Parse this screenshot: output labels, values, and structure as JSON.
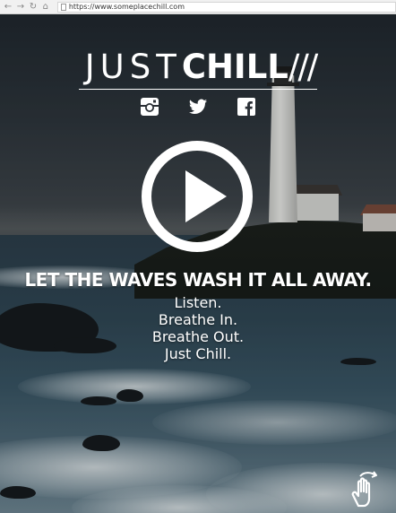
{
  "browser": {
    "back_icon": "back-arrow-icon",
    "forward_icon": "forward-arrow-icon",
    "reload_icon": "reload-icon",
    "home_icon": "home-icon",
    "url": "https://www.someplacechill.com"
  },
  "brand": {
    "word_thin": "JUST",
    "word_bold": "CHILL",
    "slashes": "///"
  },
  "socials": [
    {
      "name": "instagram-icon"
    },
    {
      "name": "twitter-icon"
    },
    {
      "name": "facebook-icon"
    }
  ],
  "hero": {
    "play_icon": "play-icon",
    "tagline": "LET THE WAVES WASH IT ALL AWAY.",
    "lines": [
      "Listen.",
      "Breathe In.",
      "Breathe Out.",
      "Just Chill."
    ]
  },
  "scroll_hint_icon": "swipe-hand-icon",
  "colors": {
    "text": "#ffffff",
    "sea": "#2f4654",
    "sky": "#2c333a"
  }
}
